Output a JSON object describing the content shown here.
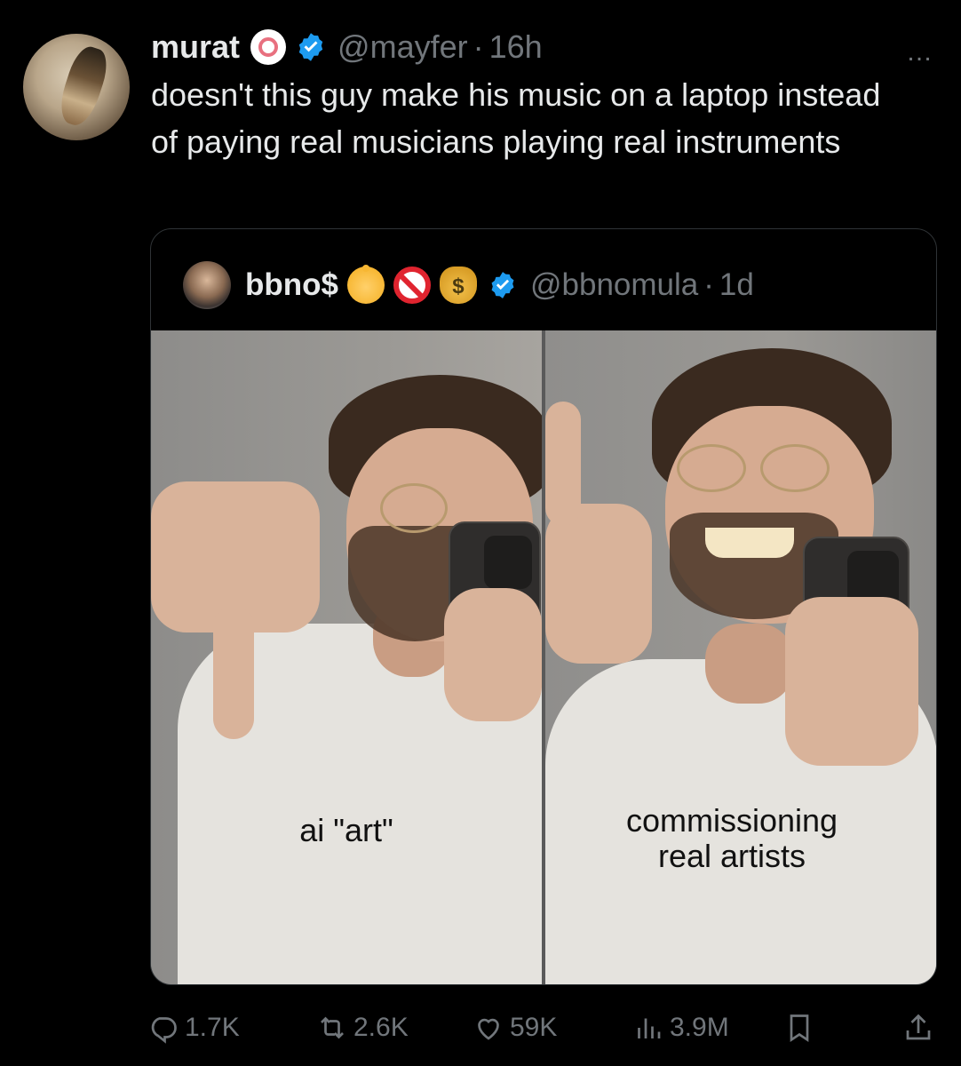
{
  "tweet": {
    "author_name": "murat",
    "author_handle": "@mayfer",
    "separator": "·",
    "time": "16h",
    "text": "doesn't this guy make his music on a laptop instead of paying real musicians playing real instruments",
    "more_icon": "…"
  },
  "quote": {
    "author_name": "bbno$",
    "author_handle": "@bbnomula",
    "separator": "·",
    "time": "1d",
    "name_emojis": [
      "baby-icon",
      "prohibited-icon",
      "money-bag-icon"
    ],
    "money_bag_glyph": "$",
    "media": {
      "left_caption": "ai \"art\"",
      "right_caption_line1": "commissioning",
      "right_caption_line2": "real artists"
    }
  },
  "actions": {
    "replies": "1.7K",
    "retweets": "2.6K",
    "likes": "59K",
    "views": "3.9M"
  },
  "colors": {
    "background": "#000000",
    "text": "#e7e9ea",
    "muted": "#71767b",
    "verified": "#1d9bf0",
    "border": "#2f3336"
  }
}
